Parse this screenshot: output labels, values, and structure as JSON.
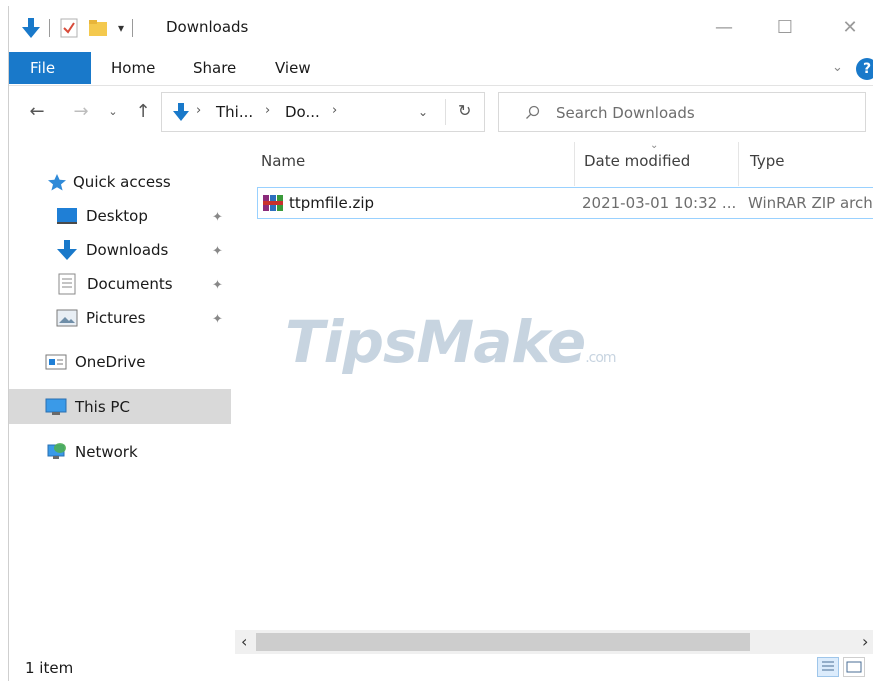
{
  "window": {
    "title": "Downloads"
  },
  "ribbon": {
    "tabs": [
      "File",
      "Home",
      "Share",
      "View"
    ],
    "help_label": "?"
  },
  "address": {
    "crumbs": [
      "Thi...",
      "Do..."
    ],
    "search_placeholder": "Search Downloads"
  },
  "navigation": {
    "quick_access": "Quick access",
    "items": [
      {
        "label": "Desktop",
        "icon": "desktop-icon",
        "pinned": true
      },
      {
        "label": "Downloads",
        "icon": "downloads-icon",
        "pinned": true
      },
      {
        "label": "Documents",
        "icon": "documents-icon",
        "pinned": true
      },
      {
        "label": "Pictures",
        "icon": "pictures-icon",
        "pinned": true
      }
    ],
    "onedrive": "OneDrive",
    "this_pc": "This PC",
    "network": "Network"
  },
  "file_list": {
    "columns": [
      "Name",
      "Date modified",
      "Type"
    ],
    "rows": [
      {
        "name": "ttpmfile.zip",
        "date_modified": "2021-03-01 10:32 ...",
        "type": "WinRAR ZIP arch"
      }
    ]
  },
  "watermark": {
    "text": "TipsMake",
    "suffix": ".com"
  },
  "status": {
    "item_count": "1 item"
  },
  "colors": {
    "accent": "#1979ca",
    "selection_border": "#99d1ff",
    "selected_nav": "#d9d9d9"
  }
}
